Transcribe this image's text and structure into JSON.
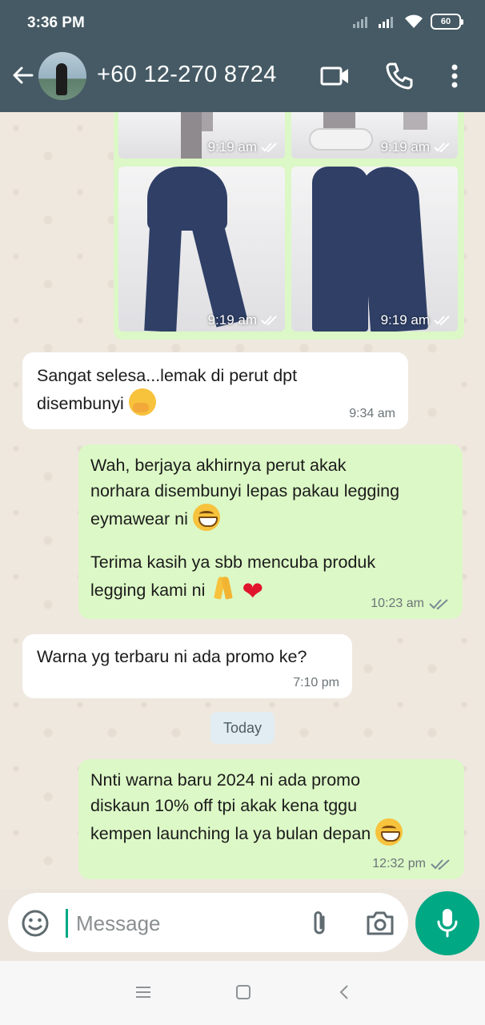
{
  "status_bar": {
    "time": "3:36 PM",
    "battery": "60"
  },
  "header": {
    "contact": "+60 12-270 8724"
  },
  "image_group": {
    "times": [
      "9:19 am",
      "9:19 am",
      "9:19 am",
      "9:19 am"
    ]
  },
  "messages": [
    {
      "text": "Sangat selesa...lemak di perut dpt\ndisembunyi ",
      "time": "9:34 am"
    },
    {
      "text": "Wah, berjaya akhirnya perut akak\nnorhara disembunyi lepas pakau legging\neymawear ni ",
      "text2": "Terima kasih ya sbb mencuba produk\nlegging kami ni ",
      "time": "10:23 am"
    },
    {
      "text": "Warna yg terbaru ni ada promo ke?",
      "time": "7:10 pm"
    },
    {
      "text": "Nnti warna baru 2024 ni ada promo\ndiskaun 10% off tpi akak kena tggu\nkempen launching la ya bulan depan ",
      "time": "12:32 pm"
    }
  ],
  "date_chip": "Today",
  "composer": {
    "placeholder": "Message"
  },
  "colors": {
    "header": "#455a64",
    "incoming": "#ffffff",
    "outgoing": "#dcf8c6",
    "accent": "#00a884",
    "read_ticks": "#7a8a93"
  }
}
